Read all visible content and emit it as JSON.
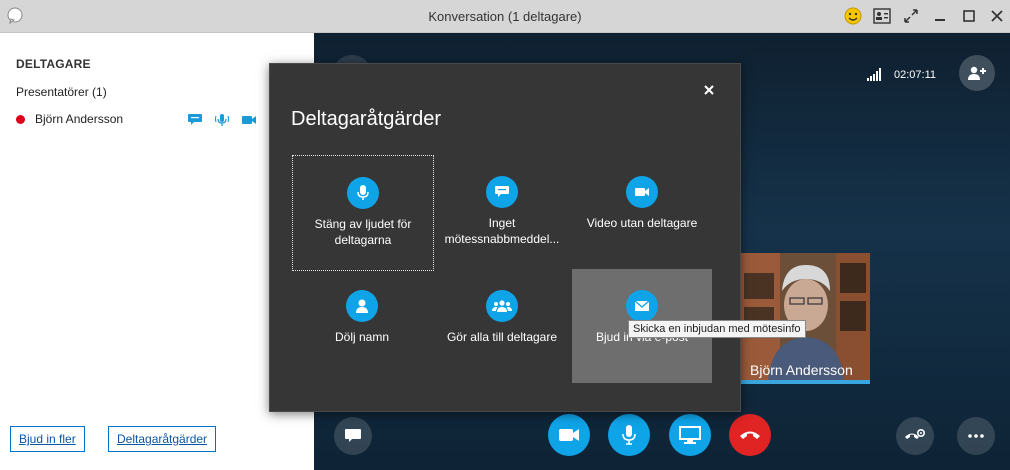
{
  "window": {
    "title": "Konversation (1 deltagare)",
    "icons": [
      "skype-logo-icon",
      "emoji-icon",
      "contact-card-icon",
      "expand-icon",
      "minimize-icon",
      "maximize-icon",
      "close-icon"
    ]
  },
  "sidebar": {
    "heading": "DELTAGARE",
    "group": "Presentatörer (1)",
    "participant": {
      "name": "Björn Andersson",
      "presence_color": "#e0001b",
      "icons": [
        "im-icon",
        "audio-icon",
        "video-icon"
      ]
    },
    "invite_label": "Bjud in fler",
    "actions_label": "Deltagaråtgärder"
  },
  "stage": {
    "timer": "02:07:11",
    "video_name": "Björn Andersson",
    "accent": "#0fa3e8",
    "hangup_color": "#e02424"
  },
  "dialog": {
    "title": "Deltagaråtgärder",
    "tiles": [
      {
        "label_line1": "Stäng av ljudet för",
        "label_line2": "deltagarna",
        "icon": "microphone-icon"
      },
      {
        "label_line1": "Inget",
        "label_line2": "mötessnabbmeddel...",
        "icon": "chat-icon"
      },
      {
        "label_line1": "Video utan deltagare",
        "label_line2": "",
        "icon": "video-camera-icon"
      },
      {
        "label_line1": "Dölj namn",
        "label_line2": "",
        "icon": "person-icon"
      },
      {
        "label_line1": "Gör alla till deltagare",
        "label_line2": "",
        "icon": "group-icon"
      },
      {
        "label_line1": "Bjud in via e-post",
        "label_line2": "",
        "icon": "mail-icon"
      }
    ],
    "tooltip": "Skicka en inbjudan med mötesinfo"
  }
}
